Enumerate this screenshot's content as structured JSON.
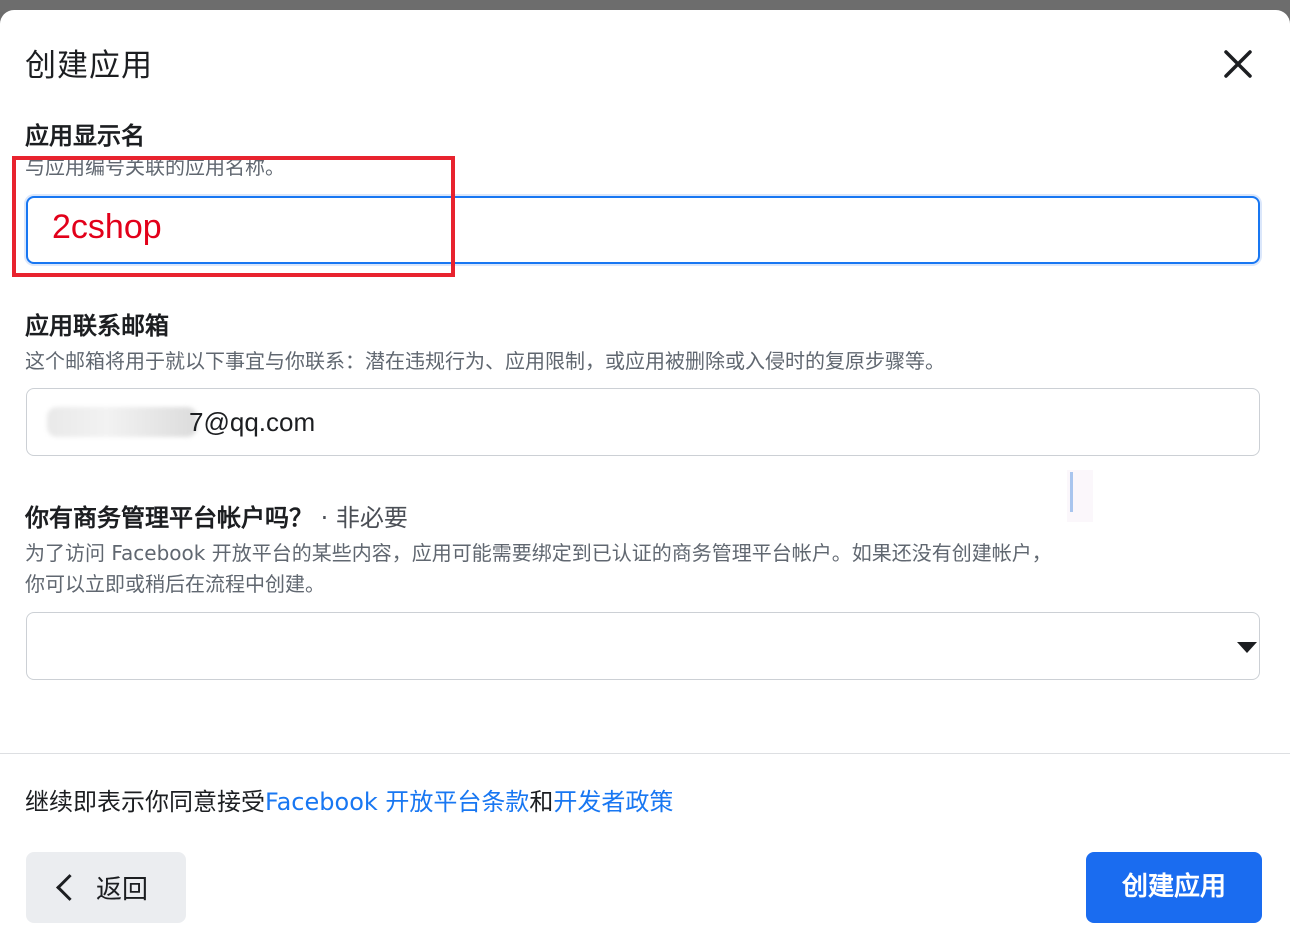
{
  "dialog": {
    "title": "创建应用",
    "close_icon": "close-icon"
  },
  "display_name": {
    "label": "应用显示名",
    "description": "与应用编号关联的应用名称。",
    "value": "2cshop"
  },
  "contact_email": {
    "label": "应用联系邮箱",
    "description": "这个邮箱将用于就以下事宜与你联系：潜在违规行为、应用限制，或应用被删除或入侵时的复原步骤等。",
    "value_visible": "7@qq.com"
  },
  "business_account": {
    "label": "你有商务管理平台帐户吗？",
    "optional": " · 非必要",
    "description_line1": "为了访问 Facebook 开放平台的某些内容，应用可能需要绑定到已认证的商务管理平台帐户。如果还没有创建帐户，",
    "description_line2": "你可以立即或稍后在流程中创建。",
    "selected": ""
  },
  "footer": {
    "terms_prefix": "继续即表示你同意接受",
    "terms_link1": "Facebook 开放平台条款",
    "terms_mid": "和",
    "terms_link2": "开发者政策",
    "back_label": "返回",
    "create_label": "创建应用"
  },
  "colors": {
    "accent": "#1a6cf0",
    "link": "#1877f2",
    "annotation": "#e8232e",
    "value_text": "#e2001a"
  }
}
